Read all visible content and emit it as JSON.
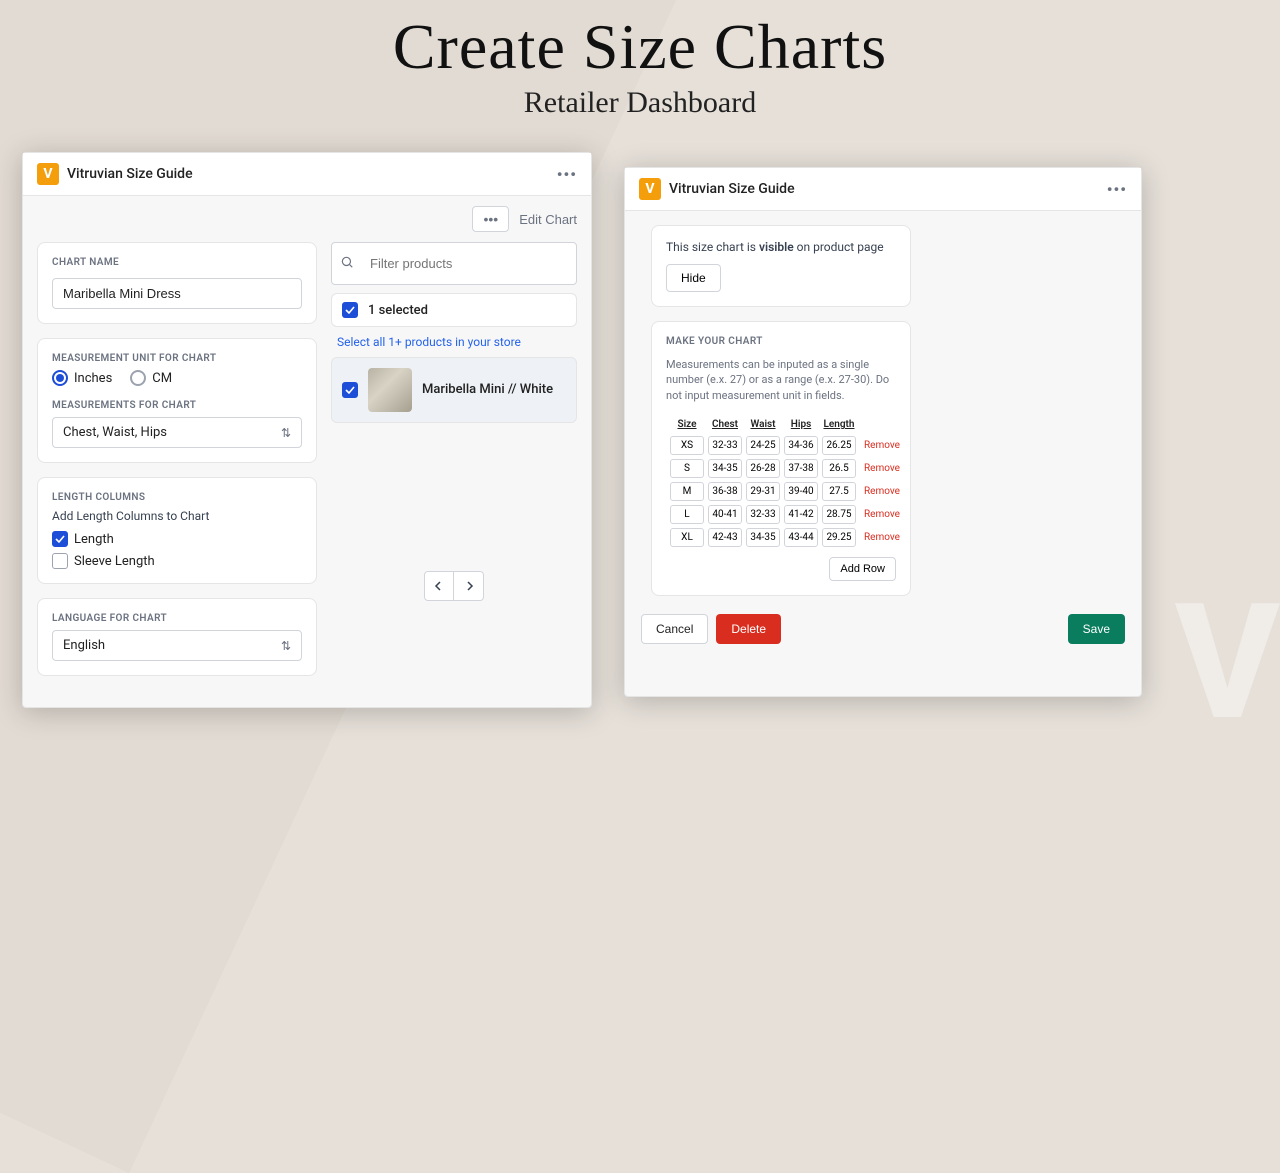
{
  "hero": {
    "title": "Create Size Charts",
    "subtitle": "Retailer Dashboard"
  },
  "brand": {
    "logo_letter": "V",
    "name": "Vitruvian Size Guide"
  },
  "left": {
    "edit_chart": "Edit Chart",
    "chart_name_label": "CHART NAME",
    "chart_name_value": "Maribella Mini Dress",
    "unit_label": "MEASUREMENT UNIT FOR CHART",
    "unit_inches": "Inches",
    "unit_cm": "CM",
    "measurements_label": "MEASUREMENTS FOR CHART",
    "measurements_value": "Chest, Waist, Hips",
    "length_label": "LENGTH COLUMNS",
    "length_help": "Add Length Columns to Chart",
    "length_option": "Length",
    "sleeve_option": "Sleeve Length",
    "lang_label": "LANGUAGE FOR CHART",
    "lang_value": "English",
    "filter_placeholder": "Filter products",
    "selected_count": "1 selected",
    "select_all": "Select all 1+ products in your store",
    "product_name": "Maribella Mini // White"
  },
  "right": {
    "visibility_pre": "This size chart is ",
    "visibility_bold": "visible",
    "visibility_post": " on product page",
    "hide": "Hide",
    "make_label": "MAKE YOUR CHART",
    "make_help": "Measurements can be inputed as a single number (e.x. 27) or as a range (e.x. 27-30). Do not input measurement unit in fields.",
    "headers": [
      "Size",
      "Chest",
      "Waist",
      "Hips",
      "Length"
    ],
    "rows": [
      {
        "size": "XS",
        "chest": "32-33",
        "waist": "24-25",
        "hips": "34-36",
        "length": "26.25"
      },
      {
        "size": "S",
        "chest": "34-35",
        "waist": "26-28",
        "hips": "37-38",
        "length": "26.5"
      },
      {
        "size": "M",
        "chest": "36-38",
        "waist": "29-31",
        "hips": "39-40",
        "length": "27.5"
      },
      {
        "size": "L",
        "chest": "40-41",
        "waist": "32-33",
        "hips": "41-42",
        "length": "28.75"
      },
      {
        "size": "XL",
        "chest": "42-43",
        "waist": "34-35",
        "hips": "43-44",
        "length": "29.25"
      }
    ],
    "remove": "Remove",
    "add_row": "Add Row",
    "cancel": "Cancel",
    "delete": "Delete",
    "save": "Save"
  }
}
